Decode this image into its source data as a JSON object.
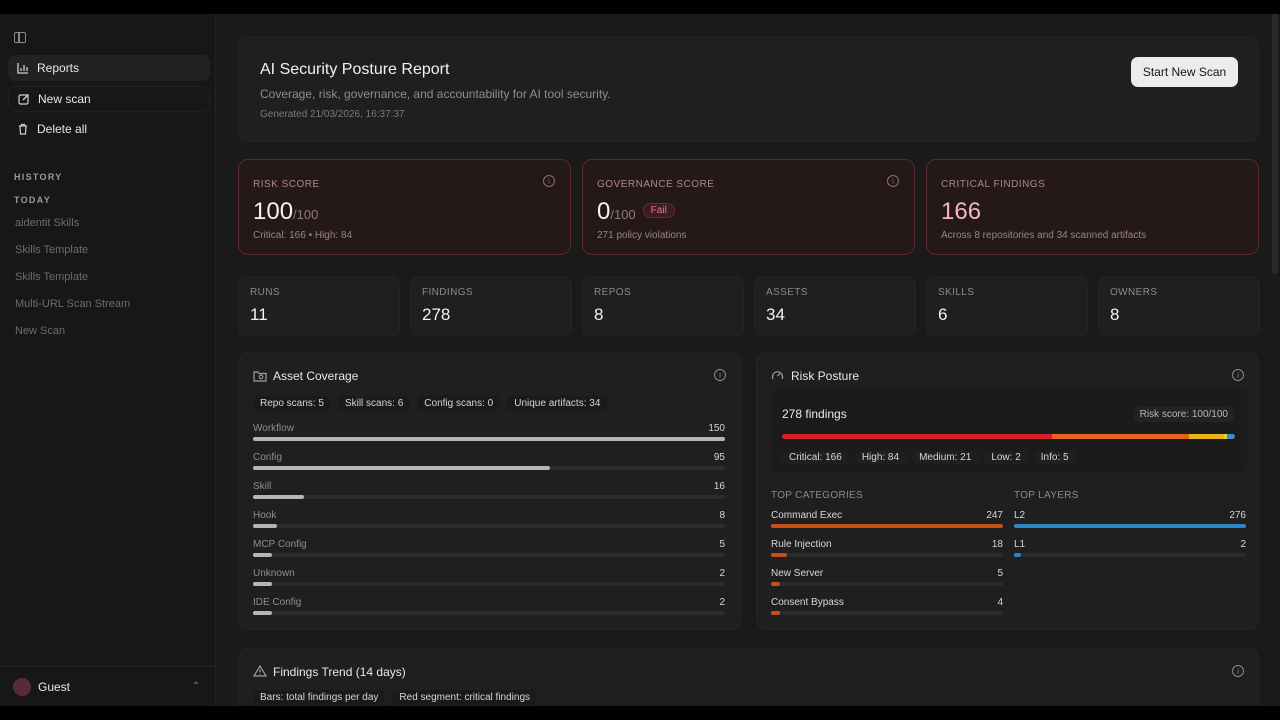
{
  "sidebar": {
    "items": [
      {
        "label": "Reports",
        "icon": "bar-chart-icon"
      },
      {
        "label": "New scan",
        "icon": "edit-icon"
      },
      {
        "label": "Delete all",
        "icon": "trash-icon"
      }
    ],
    "history_label": "HISTORY",
    "today_label": "TODAY",
    "history": [
      "aidentit Skills",
      "Skills Template",
      "Skills Template",
      "Multi-URL Scan Stream",
      "New Scan"
    ],
    "user": "Guest"
  },
  "header": {
    "title": "AI Security Posture Report",
    "subtitle": "Coverage, risk, governance, and accountability for AI tool security.",
    "generated": "Generated 21/03/2026, 16:37:37",
    "scan_button": "Start New Scan"
  },
  "scores": {
    "risk": {
      "label": "RISK SCORE",
      "value": "100",
      "denominator": "/100",
      "sub": "Critical: 166 • High: 84"
    },
    "governance": {
      "label": "GOVERNANCE SCORE",
      "value": "0",
      "denominator": "/100",
      "badge": "Fail",
      "sub": "271 policy violations"
    },
    "critical": {
      "label": "CRITICAL FINDINGS",
      "value": "166",
      "sub": "Across 8 repositories and 34 scanned artifacts"
    }
  },
  "stats": [
    {
      "label": "RUNS",
      "value": "11"
    },
    {
      "label": "FINDINGS",
      "value": "278"
    },
    {
      "label": "REPOS",
      "value": "8"
    },
    {
      "label": "ASSETS",
      "value": "34"
    },
    {
      "label": "SKILLS",
      "value": "6"
    },
    {
      "label": "OWNERS",
      "value": "8"
    }
  ],
  "coverage": {
    "title": "Asset Coverage",
    "pills": [
      "Repo scans: 5",
      "Skill scans: 6",
      "Config scans: 0",
      "Unique artifacts: 34"
    ],
    "rows": [
      {
        "name": "Workflow",
        "value": "150",
        "fraction": 1.0
      },
      {
        "name": "Config",
        "value": "95",
        "fraction": 0.63
      },
      {
        "name": "Skill",
        "value": "16",
        "fraction": 0.107
      },
      {
        "name": "Hook",
        "value": "8",
        "fraction": 0.05
      },
      {
        "name": "MCP Config",
        "value": "5",
        "fraction": 0.04
      },
      {
        "name": "Unknown",
        "value": "2",
        "fraction": 0.04
      },
      {
        "name": "IDE Config",
        "value": "2",
        "fraction": 0.04
      }
    ]
  },
  "risk_posture": {
    "title": "Risk Posture",
    "findings": "278 findings",
    "score": "Risk score: 100/100",
    "severity": [
      {
        "label": "Critical: 166",
        "count": 166,
        "color": "#d6212a"
      },
      {
        "label": "High: 84",
        "count": 84,
        "color": "#e8621c"
      },
      {
        "label": "Medium: 21",
        "count": 21,
        "color": "#e8b21c"
      },
      {
        "label": "Low: 2",
        "count": 2,
        "color": "#e8d41c"
      },
      {
        "label": "Info: 5",
        "count": 5,
        "color": "#3b8fd0"
      }
    ],
    "categories_label": "TOP CATEGORIES",
    "categories": [
      {
        "name": "Command Exec",
        "value": "247",
        "fraction": 1.0
      },
      {
        "name": "Rule Injection",
        "value": "18",
        "fraction": 0.07
      },
      {
        "name": "New Server",
        "value": "5",
        "fraction": 0.04
      },
      {
        "name": "Consent Bypass",
        "value": "4",
        "fraction": 0.04
      }
    ],
    "category_color": "#c64f18",
    "layers_label": "TOP LAYERS",
    "layers": [
      {
        "name": "L2",
        "value": "276",
        "fraction": 1.0
      },
      {
        "name": "L1",
        "value": "2",
        "fraction": 0.03
      }
    ],
    "layer_color": "#2b86c4"
  },
  "trend": {
    "title": "Findings Trend (14 days)",
    "pills": [
      "Bars: total findings per day",
      "Red segment: critical findings"
    ]
  }
}
